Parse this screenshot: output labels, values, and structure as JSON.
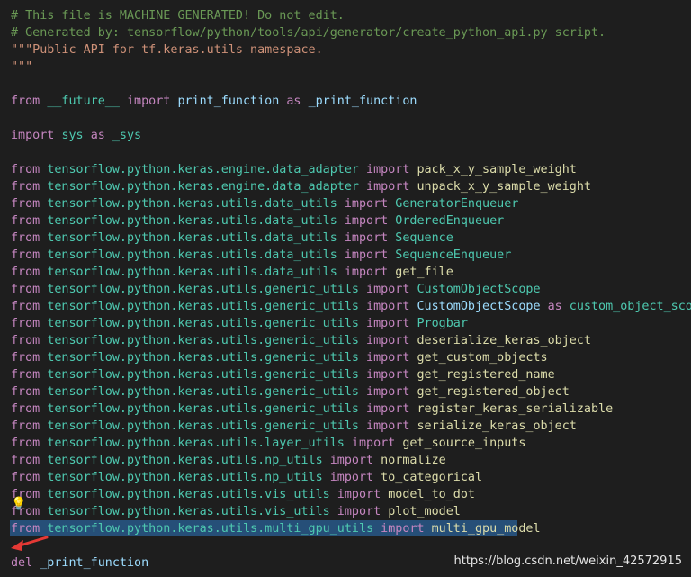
{
  "editor": {
    "lines": [
      {
        "tokens": [
          {
            "t": "# This file is MACHINE GENERATED! Do not edit.",
            "c": "cm"
          }
        ]
      },
      {
        "tokens": [
          {
            "t": "# Generated by: tensorflow/python/tools/api/generator/create_python_api.py script.",
            "c": "cm"
          }
        ]
      },
      {
        "tokens": [
          {
            "t": "\"\"\"Public API for tf.keras.utils namespace.",
            "c": "str"
          }
        ]
      },
      {
        "tokens": [
          {
            "t": "\"\"\"",
            "c": "str"
          }
        ]
      },
      {
        "tokens": []
      },
      {
        "tokens": [
          {
            "t": "from",
            "c": "kw"
          },
          {
            "t": " ",
            "c": ""
          },
          {
            "t": "__future__",
            "c": "mod"
          },
          {
            "t": " ",
            "c": ""
          },
          {
            "t": "import",
            "c": "kw"
          },
          {
            "t": " ",
            "c": ""
          },
          {
            "t": "print_function",
            "c": "alias"
          },
          {
            "t": " ",
            "c": ""
          },
          {
            "t": "as",
            "c": "kw"
          },
          {
            "t": " ",
            "c": ""
          },
          {
            "t": "_print_function",
            "c": "alias"
          }
        ]
      },
      {
        "tokens": []
      },
      {
        "tokens": [
          {
            "t": "import",
            "c": "kw"
          },
          {
            "t": " ",
            "c": ""
          },
          {
            "t": "sys",
            "c": "mod"
          },
          {
            "t": " ",
            "c": ""
          },
          {
            "t": "as",
            "c": "kw"
          },
          {
            "t": " ",
            "c": ""
          },
          {
            "t": "_sys",
            "c": "mod"
          }
        ]
      },
      {
        "tokens": []
      },
      {
        "tokens": [
          {
            "t": "from",
            "c": "kw"
          },
          {
            "t": " ",
            "c": ""
          },
          {
            "t": "tensorflow.python.keras.engine.data_adapter",
            "c": "mod"
          },
          {
            "t": " ",
            "c": ""
          },
          {
            "t": "import",
            "c": "kw"
          },
          {
            "t": " ",
            "c": ""
          },
          {
            "t": "pack_x_y_sample_weight",
            "c": "imp-fn"
          }
        ]
      },
      {
        "tokens": [
          {
            "t": "from",
            "c": "kw"
          },
          {
            "t": " ",
            "c": ""
          },
          {
            "t": "tensorflow.python.keras.engine.data_adapter",
            "c": "mod"
          },
          {
            "t": " ",
            "c": ""
          },
          {
            "t": "import",
            "c": "kw"
          },
          {
            "t": " ",
            "c": ""
          },
          {
            "t": "unpack_x_y_sample_weight",
            "c": "imp-fn"
          }
        ]
      },
      {
        "tokens": [
          {
            "t": "from",
            "c": "kw"
          },
          {
            "t": " ",
            "c": ""
          },
          {
            "t": "tensorflow.python.keras.utils.data_utils",
            "c": "mod"
          },
          {
            "t": " ",
            "c": ""
          },
          {
            "t": "import",
            "c": "kw"
          },
          {
            "t": " ",
            "c": ""
          },
          {
            "t": "GeneratorEnqueuer",
            "c": "imp-cls"
          }
        ]
      },
      {
        "tokens": [
          {
            "t": "from",
            "c": "kw"
          },
          {
            "t": " ",
            "c": ""
          },
          {
            "t": "tensorflow.python.keras.utils.data_utils",
            "c": "mod"
          },
          {
            "t": " ",
            "c": ""
          },
          {
            "t": "import",
            "c": "kw"
          },
          {
            "t": " ",
            "c": ""
          },
          {
            "t": "OrderedEnqueuer",
            "c": "imp-cls"
          }
        ]
      },
      {
        "tokens": [
          {
            "t": "from",
            "c": "kw"
          },
          {
            "t": " ",
            "c": ""
          },
          {
            "t": "tensorflow.python.keras.utils.data_utils",
            "c": "mod"
          },
          {
            "t": " ",
            "c": ""
          },
          {
            "t": "import",
            "c": "kw"
          },
          {
            "t": " ",
            "c": ""
          },
          {
            "t": "Sequence",
            "c": "imp-cls"
          }
        ]
      },
      {
        "tokens": [
          {
            "t": "from",
            "c": "kw"
          },
          {
            "t": " ",
            "c": ""
          },
          {
            "t": "tensorflow.python.keras.utils.data_utils",
            "c": "mod"
          },
          {
            "t": " ",
            "c": ""
          },
          {
            "t": "import",
            "c": "kw"
          },
          {
            "t": " ",
            "c": ""
          },
          {
            "t": "SequenceEnqueuer",
            "c": "imp-cls"
          }
        ]
      },
      {
        "tokens": [
          {
            "t": "from",
            "c": "kw"
          },
          {
            "t": " ",
            "c": ""
          },
          {
            "t": "tensorflow.python.keras.utils.data_utils",
            "c": "mod"
          },
          {
            "t": " ",
            "c": ""
          },
          {
            "t": "import",
            "c": "kw"
          },
          {
            "t": " ",
            "c": ""
          },
          {
            "t": "get_file",
            "c": "imp-fn"
          }
        ]
      },
      {
        "tokens": [
          {
            "t": "from",
            "c": "kw"
          },
          {
            "t": " ",
            "c": ""
          },
          {
            "t": "tensorflow.python.keras.utils.generic_utils",
            "c": "mod"
          },
          {
            "t": " ",
            "c": ""
          },
          {
            "t": "import",
            "c": "kw"
          },
          {
            "t": " ",
            "c": ""
          },
          {
            "t": "CustomObjectScope",
            "c": "imp-cls"
          }
        ]
      },
      {
        "tokens": [
          {
            "t": "from",
            "c": "kw"
          },
          {
            "t": " ",
            "c": ""
          },
          {
            "t": "tensorflow.python.keras.utils.generic_utils",
            "c": "mod"
          },
          {
            "t": " ",
            "c": ""
          },
          {
            "t": "import",
            "c": "kw"
          },
          {
            "t": " ",
            "c": ""
          },
          {
            "t": "CustomObjectScope",
            "c": "alias"
          },
          {
            "t": " ",
            "c": ""
          },
          {
            "t": "as",
            "c": "kw"
          },
          {
            "t": " ",
            "c": ""
          },
          {
            "t": "custom_object_scope",
            "c": "imp-cls"
          }
        ]
      },
      {
        "tokens": [
          {
            "t": "from",
            "c": "kw"
          },
          {
            "t": " ",
            "c": ""
          },
          {
            "t": "tensorflow.python.keras.utils.generic_utils",
            "c": "mod"
          },
          {
            "t": " ",
            "c": ""
          },
          {
            "t": "import",
            "c": "kw"
          },
          {
            "t": " ",
            "c": ""
          },
          {
            "t": "Progbar",
            "c": "imp-cls"
          }
        ]
      },
      {
        "tokens": [
          {
            "t": "from",
            "c": "kw"
          },
          {
            "t": " ",
            "c": ""
          },
          {
            "t": "tensorflow.python.keras.utils.generic_utils",
            "c": "mod"
          },
          {
            "t": " ",
            "c": ""
          },
          {
            "t": "import",
            "c": "kw"
          },
          {
            "t": " ",
            "c": ""
          },
          {
            "t": "deserialize_keras_object",
            "c": "imp-fn"
          }
        ]
      },
      {
        "tokens": [
          {
            "t": "from",
            "c": "kw"
          },
          {
            "t": " ",
            "c": ""
          },
          {
            "t": "tensorflow.python.keras.utils.generic_utils",
            "c": "mod"
          },
          {
            "t": " ",
            "c": ""
          },
          {
            "t": "import",
            "c": "kw"
          },
          {
            "t": " ",
            "c": ""
          },
          {
            "t": "get_custom_objects",
            "c": "imp-fn"
          }
        ]
      },
      {
        "tokens": [
          {
            "t": "from",
            "c": "kw"
          },
          {
            "t": " ",
            "c": ""
          },
          {
            "t": "tensorflow.python.keras.utils.generic_utils",
            "c": "mod"
          },
          {
            "t": " ",
            "c": ""
          },
          {
            "t": "import",
            "c": "kw"
          },
          {
            "t": " ",
            "c": ""
          },
          {
            "t": "get_registered_name",
            "c": "imp-fn"
          }
        ]
      },
      {
        "tokens": [
          {
            "t": "from",
            "c": "kw"
          },
          {
            "t": " ",
            "c": ""
          },
          {
            "t": "tensorflow.python.keras.utils.generic_utils",
            "c": "mod"
          },
          {
            "t": " ",
            "c": ""
          },
          {
            "t": "import",
            "c": "kw"
          },
          {
            "t": " ",
            "c": ""
          },
          {
            "t": "get_registered_object",
            "c": "imp-fn"
          }
        ]
      },
      {
        "tokens": [
          {
            "t": "from",
            "c": "kw"
          },
          {
            "t": " ",
            "c": ""
          },
          {
            "t": "tensorflow.python.keras.utils.generic_utils",
            "c": "mod"
          },
          {
            "t": " ",
            "c": ""
          },
          {
            "t": "import",
            "c": "kw"
          },
          {
            "t": " ",
            "c": ""
          },
          {
            "t": "register_keras_serializable",
            "c": "imp-fn"
          }
        ]
      },
      {
        "tokens": [
          {
            "t": "from",
            "c": "kw"
          },
          {
            "t": " ",
            "c": ""
          },
          {
            "t": "tensorflow.python.keras.utils.generic_utils",
            "c": "mod"
          },
          {
            "t": " ",
            "c": ""
          },
          {
            "t": "import",
            "c": "kw"
          },
          {
            "t": " ",
            "c": ""
          },
          {
            "t": "serialize_keras_object",
            "c": "imp-fn"
          }
        ]
      },
      {
        "tokens": [
          {
            "t": "from",
            "c": "kw"
          },
          {
            "t": " ",
            "c": ""
          },
          {
            "t": "tensorflow.python.keras.utils.layer_utils",
            "c": "mod"
          },
          {
            "t": " ",
            "c": ""
          },
          {
            "t": "import",
            "c": "kw"
          },
          {
            "t": " ",
            "c": ""
          },
          {
            "t": "get_source_inputs",
            "c": "imp-fn"
          }
        ]
      },
      {
        "tokens": [
          {
            "t": "from",
            "c": "kw"
          },
          {
            "t": " ",
            "c": ""
          },
          {
            "t": "tensorflow.python.keras.utils.np_utils",
            "c": "mod"
          },
          {
            "t": " ",
            "c": ""
          },
          {
            "t": "import",
            "c": "kw"
          },
          {
            "t": " ",
            "c": ""
          },
          {
            "t": "normalize",
            "c": "imp-fn"
          }
        ]
      },
      {
        "tokens": [
          {
            "t": "from",
            "c": "kw"
          },
          {
            "t": " ",
            "c": ""
          },
          {
            "t": "tensorflow.python.keras.utils.np_utils",
            "c": "mod"
          },
          {
            "t": " ",
            "c": ""
          },
          {
            "t": "import",
            "c": "kw"
          },
          {
            "t": " ",
            "c": ""
          },
          {
            "t": "to_categorical",
            "c": "imp-fn"
          }
        ]
      },
      {
        "tokens": [
          {
            "t": "from",
            "c": "kw"
          },
          {
            "t": " ",
            "c": ""
          },
          {
            "t": "tensorflow.python.keras.utils.vis_utils",
            "c": "mod"
          },
          {
            "t": " ",
            "c": ""
          },
          {
            "t": "import",
            "c": "kw"
          },
          {
            "t": " ",
            "c": ""
          },
          {
            "t": "model_to_dot",
            "c": "imp-fn"
          }
        ]
      },
      {
        "tokens": [
          {
            "t": "from",
            "c": "kw"
          },
          {
            "t": " ",
            "c": ""
          },
          {
            "t": "tensorflow.python.keras.utils.vis_utils",
            "c": "mod"
          },
          {
            "t": " ",
            "c": ""
          },
          {
            "t": "import",
            "c": "kw"
          },
          {
            "t": " ",
            "c": ""
          },
          {
            "t": "plot_model",
            "c": "imp-fn"
          }
        ]
      },
      {
        "tokens": [
          {
            "t": "from",
            "c": "kw"
          },
          {
            "t": " ",
            "c": ""
          },
          {
            "t": "tensorflow.python.keras.utils.multi_gpu_utils",
            "c": "mod"
          },
          {
            "t": " ",
            "c": ""
          },
          {
            "t": "import",
            "c": "kw"
          },
          {
            "t": " ",
            "c": ""
          },
          {
            "t": "multi_gpu_model",
            "c": "imp-fn"
          }
        ]
      },
      {
        "tokens": []
      },
      {
        "tokens": [
          {
            "t": "del",
            "c": "kw"
          },
          {
            "t": " ",
            "c": ""
          },
          {
            "t": "_print_function",
            "c": "alias"
          }
        ]
      }
    ]
  },
  "lightbulb_icon": "lightbulb-icon",
  "annotation_arrow_color": "#e53935",
  "watermark": "https://blog.csdn.net/weixin_42572915"
}
